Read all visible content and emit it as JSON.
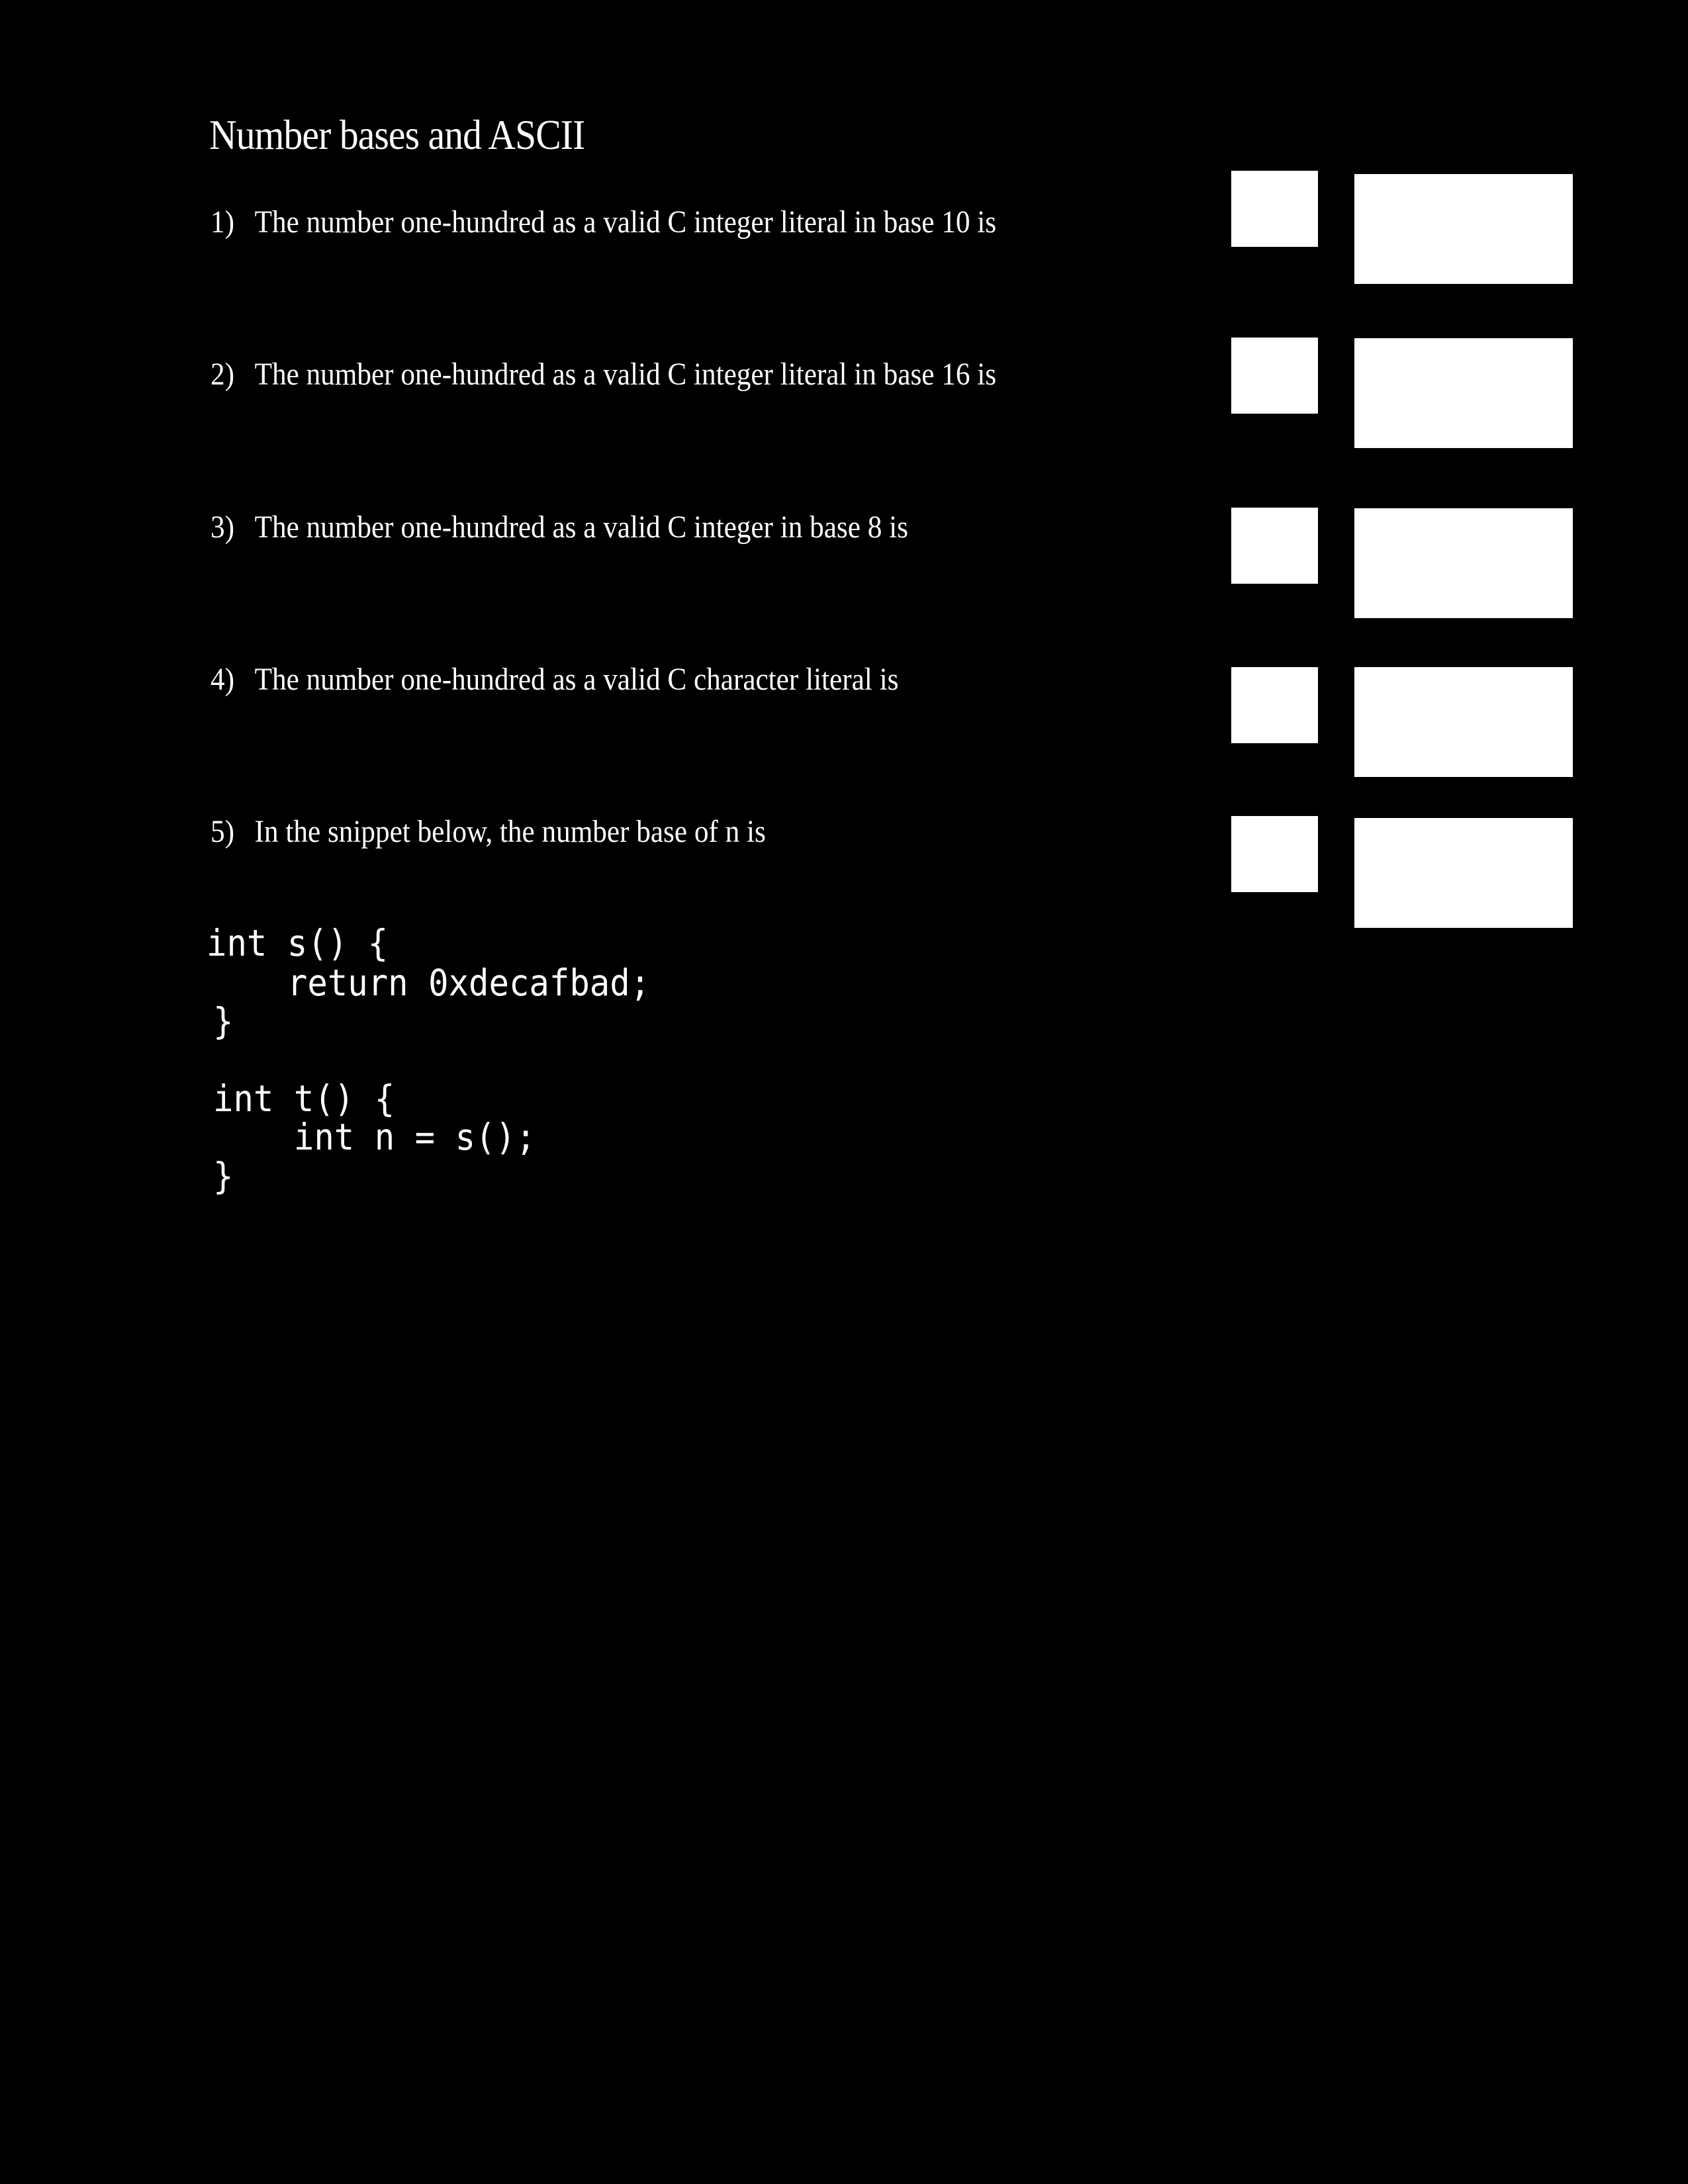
{
  "document": {
    "title": "Number bases and ASCII",
    "questions": [
      {
        "number": "1)",
        "text": "The number one-hundred as a valid C integer literal in base 10 is"
      },
      {
        "number": "2)",
        "text": "The number one-hundred as a valid C integer literal in base 16 is"
      },
      {
        "number": "3)",
        "text": "The number one-hundred as a valid C integer in base 8 is"
      },
      {
        "number": "4)",
        "text": "The number one-hundred as a valid C character literal is"
      },
      {
        "number": "5)",
        "text": "In the snippet below, the number base of n is"
      }
    ],
    "answer_boxes": [
      {
        "question": 1,
        "small": "",
        "wide": ""
      },
      {
        "question": 2,
        "small": "",
        "wide": ""
      },
      {
        "question": 3,
        "small": "",
        "wide": ""
      },
      {
        "question": 4,
        "small": "",
        "wide": ""
      },
      {
        "question": 5,
        "small": "",
        "wide": ""
      }
    ],
    "code_snippet": {
      "lines": [
        "int s() {",
        "    return 0xdecafbad;",
        "}",
        "int t() {",
        "    int n = s();",
        "}"
      ]
    }
  },
  "colors": {
    "background": "#000000",
    "text": "#ffffff",
    "answer_box": "#ffffff"
  }
}
